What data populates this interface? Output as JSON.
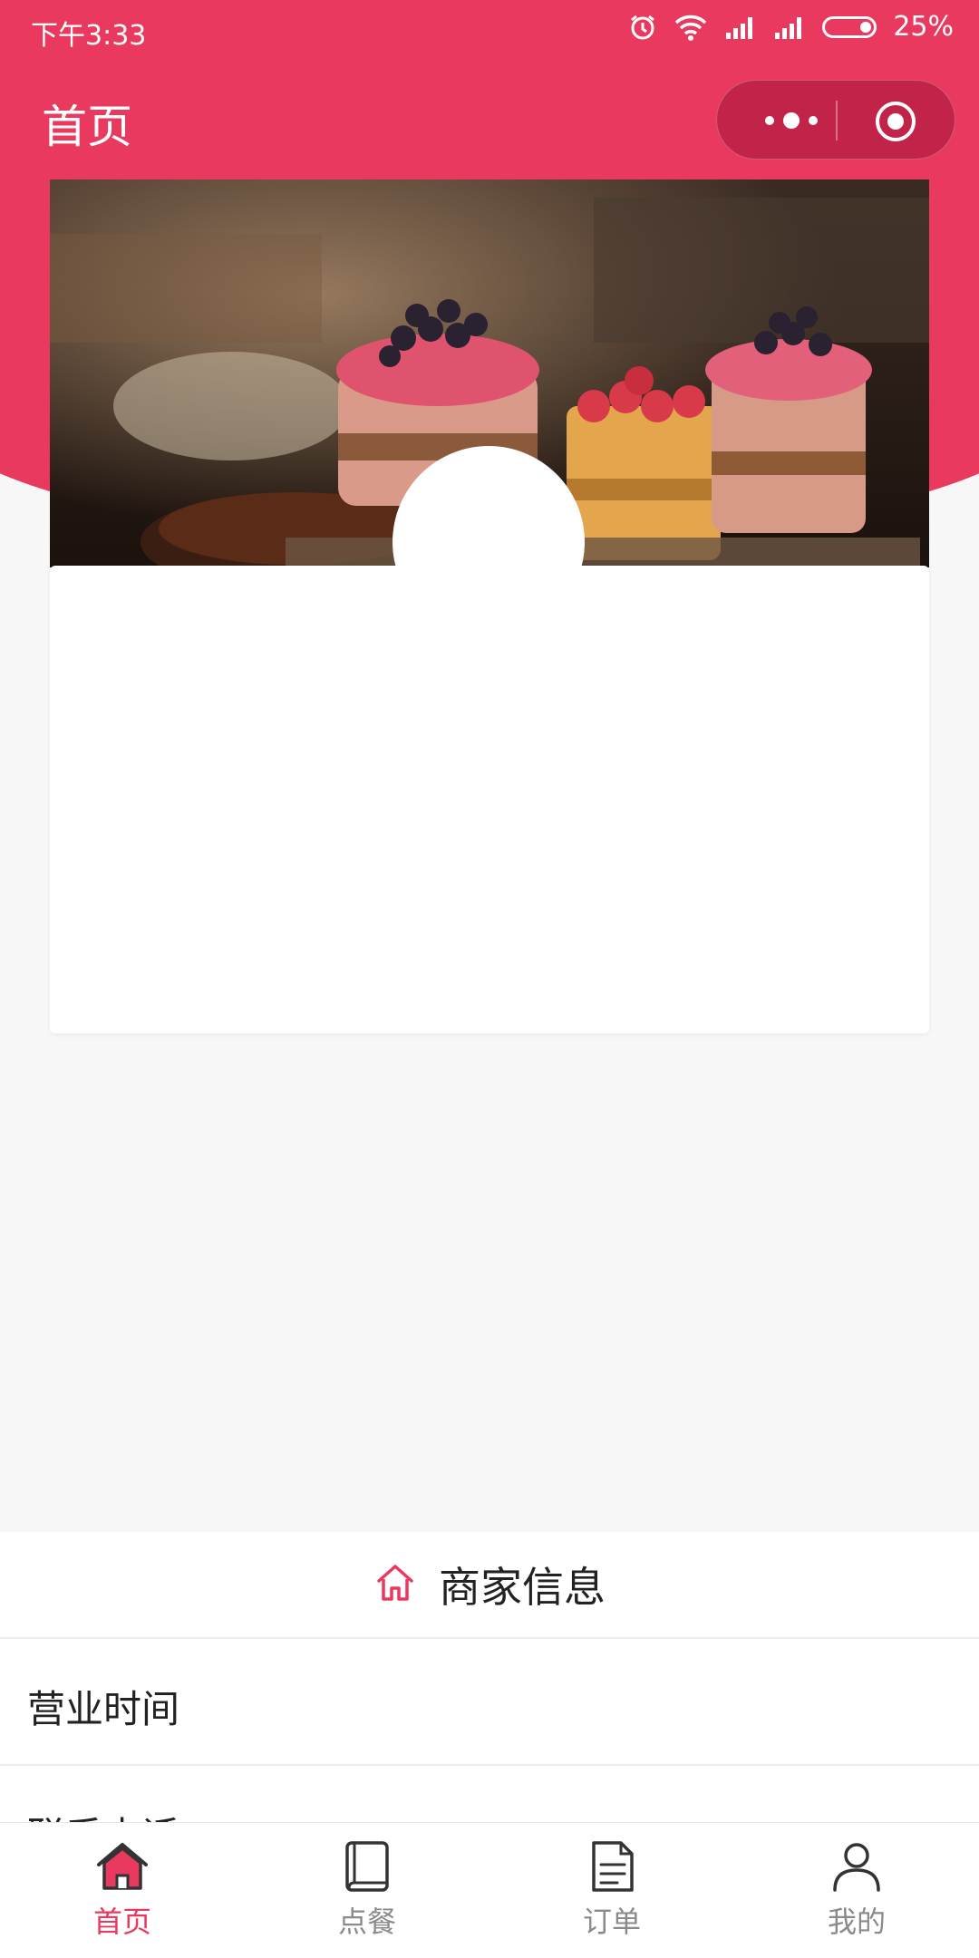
{
  "status_bar": {
    "time": "下午3:33",
    "battery": "25%",
    "icons": [
      "alarm-icon",
      "wifi-icon",
      "signal-icon",
      "signal-icon",
      "battery-icon"
    ]
  },
  "nav": {
    "title": "首页",
    "capsule_icons": [
      "more-icon",
      "target-icon"
    ]
  },
  "theme": {
    "primary": "#e9395f",
    "tab_inactive": "#8a8a8a",
    "background": "#f7f7f7"
  },
  "merchant_info": {
    "header": "商家信息",
    "header_icon": "home-outline-icon",
    "rows": [
      {
        "label": "营业时间"
      },
      {
        "label": "联系电话"
      }
    ]
  },
  "tab_bar": {
    "tabs": [
      {
        "label": "首页",
        "icon": "home-icon",
        "active": true
      },
      {
        "label": "点餐",
        "icon": "menu-book-icon",
        "active": false
      },
      {
        "label": "订单",
        "icon": "order-doc-icon",
        "active": false
      },
      {
        "label": "我的",
        "icon": "person-icon",
        "active": false
      }
    ]
  }
}
